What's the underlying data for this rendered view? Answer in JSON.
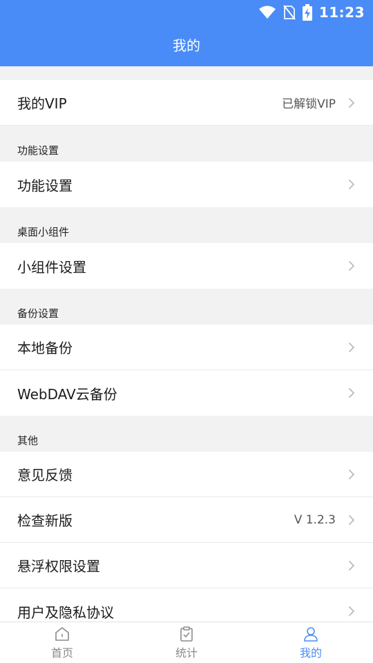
{
  "status_bar": {
    "time": "11:23"
  },
  "header": {
    "title": "我的"
  },
  "vip": {
    "label": "我的VIP",
    "value": "已解锁VIP"
  },
  "sections": [
    {
      "title": "功能设置",
      "items": [
        {
          "label": "功能设置",
          "value": ""
        }
      ]
    },
    {
      "title": "桌面小组件",
      "items": [
        {
          "label": "小组件设置",
          "value": ""
        }
      ]
    },
    {
      "title": "备份设置",
      "items": [
        {
          "label": "本地备份",
          "value": ""
        },
        {
          "label": "WebDAV云备份",
          "value": ""
        }
      ]
    },
    {
      "title": "其他",
      "items": [
        {
          "label": "意见反馈",
          "value": ""
        },
        {
          "label": "检查新版",
          "value": "V 1.2.3"
        },
        {
          "label": "悬浮权限设置",
          "value": ""
        },
        {
          "label": "用户及隐私协议",
          "value": ""
        }
      ]
    }
  ],
  "tabbar": {
    "active": "我的",
    "tabs": [
      {
        "label": "首页",
        "icon": "home-icon"
      },
      {
        "label": "统计",
        "icon": "clipboard-check-icon"
      },
      {
        "label": "我的",
        "icon": "user-icon"
      }
    ]
  },
  "colors": {
    "accent": "#4a8cf7",
    "background": "#f2f2f2",
    "text": "#1b1b1b",
    "inactive_tab": "#8a8a8a"
  }
}
